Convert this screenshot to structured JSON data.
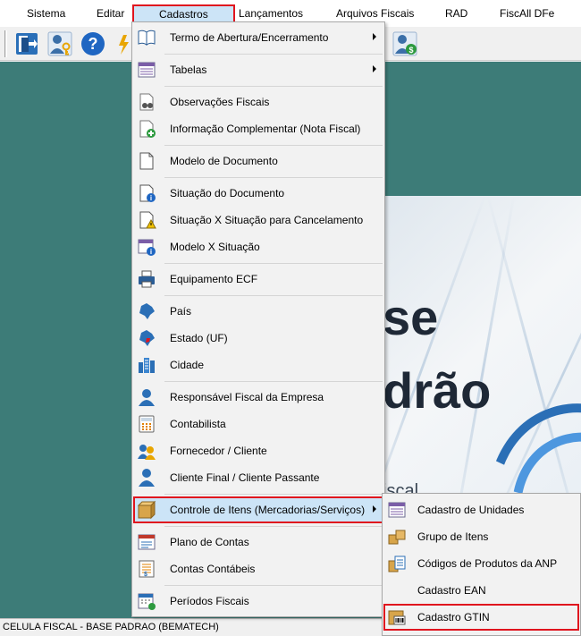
{
  "menubar": {
    "items": [
      "Sistema",
      "Editar",
      "Cadastros",
      "Lançamentos",
      "Arquivos Fiscais",
      "RAD",
      "FiscAll DFe"
    ]
  },
  "toolbar": {
    "icons": [
      "exit-door-icon",
      "user-key-icon",
      "help-icon",
      "partial-icon",
      "user-money-icon"
    ]
  },
  "splash": {
    "line1": "se",
    "line2": "drão",
    "line3": "iscal"
  },
  "statusbar": {
    "text": "CELULA FISCAL - BASE PADRAO (BEMATECH)"
  },
  "cadastros_menu": {
    "items": [
      {
        "label": "Termo de Abertura/Encerramento",
        "icon": "book-icon",
        "submenu": true
      },
      {
        "label": "Tabelas",
        "icon": "table-icon",
        "submenu": true
      },
      {
        "label": "Observações Fiscais",
        "icon": "document-binoculars-icon"
      },
      {
        "label": "Informação Complementar (Nota Fiscal)",
        "icon": "document-plus-icon"
      },
      {
        "label": "Modelo de Documento",
        "icon": "document-icon"
      },
      {
        "label": "Situação do Documento",
        "icon": "document-info-icon"
      },
      {
        "label": "Situação X Situação para Cancelamento",
        "icon": "document-warning-icon"
      },
      {
        "label": "Modelo X Situação",
        "icon": "list-info-icon"
      },
      {
        "label": "Equipamento ECF",
        "icon": "printer-icon"
      },
      {
        "label": "País",
        "icon": "brazil-map-icon"
      },
      {
        "label": "Estado (UF)",
        "icon": "brazil-state-map-icon"
      },
      {
        "label": "Cidade",
        "icon": "city-buildings-icon"
      },
      {
        "label": "Responsável Fiscal da Empresa",
        "icon": "user-icon"
      },
      {
        "label": "Contabilista",
        "icon": "calculator-icon"
      },
      {
        "label": "Fornecedor / Cliente",
        "icon": "users-icon"
      },
      {
        "label": "Cliente Final / Cliente Passante",
        "icon": "person-icon"
      },
      {
        "label": "Controle de Itens (Mercadorias/Serviços)",
        "icon": "boxes-icon",
        "submenu": true
      },
      {
        "label": "Plano de Contas",
        "icon": "chart-of-accounts-icon"
      },
      {
        "label": "Contas Contábeis",
        "icon": "ledger-icon"
      },
      {
        "label": "Períodos Fiscais",
        "icon": "calendar-money-icon"
      }
    ]
  },
  "itens_submenu": {
    "items": [
      {
        "label": "Cadastro de Unidades",
        "icon": "units-list-icon"
      },
      {
        "label": "Grupo de Itens",
        "icon": "boxes-group-icon"
      },
      {
        "label": "Códigos de Produtos da ANP",
        "icon": "anp-codes-icon"
      },
      {
        "label": "Cadastro EAN",
        "icon": ""
      },
      {
        "label": "Cadastro GTIN",
        "icon": "barcode-box-icon"
      }
    ]
  },
  "colors": {
    "background": "#3d7c78",
    "highlight": "#cce4f7",
    "red_outline": "#e0141e",
    "menu_bg": "#f2f2f2"
  }
}
